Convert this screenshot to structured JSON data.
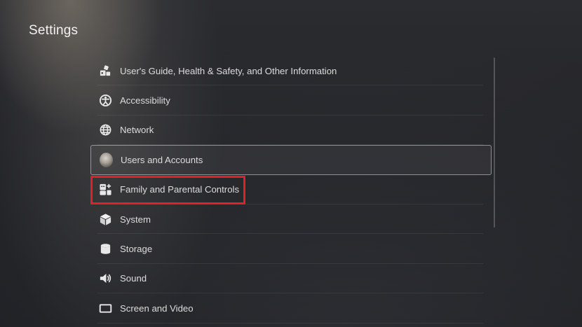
{
  "header": {
    "title": "Settings"
  },
  "menu": {
    "items": [
      {
        "label": "User's Guide, Health & Safety, and Other Information",
        "icon": "guide-icon"
      },
      {
        "label": "Accessibility",
        "icon": "accessibility-icon"
      },
      {
        "label": "Network",
        "icon": "globe-icon"
      },
      {
        "label": "Users and Accounts",
        "icon": "avatar"
      },
      {
        "label": "Family and Parental Controls",
        "icon": "family-controls-icon"
      },
      {
        "label": "System",
        "icon": "cube-icon"
      },
      {
        "label": "Storage",
        "icon": "database-icon"
      },
      {
        "label": "Sound",
        "icon": "speaker-icon"
      },
      {
        "label": "Screen and Video",
        "icon": "screen-icon"
      }
    ],
    "focused_item": "Users and Accounts",
    "highlighted_item": "Family and Parental Controls"
  },
  "colors": {
    "highlight": "#e0202a",
    "background": "#232428",
    "text": "#dcdcdc"
  }
}
